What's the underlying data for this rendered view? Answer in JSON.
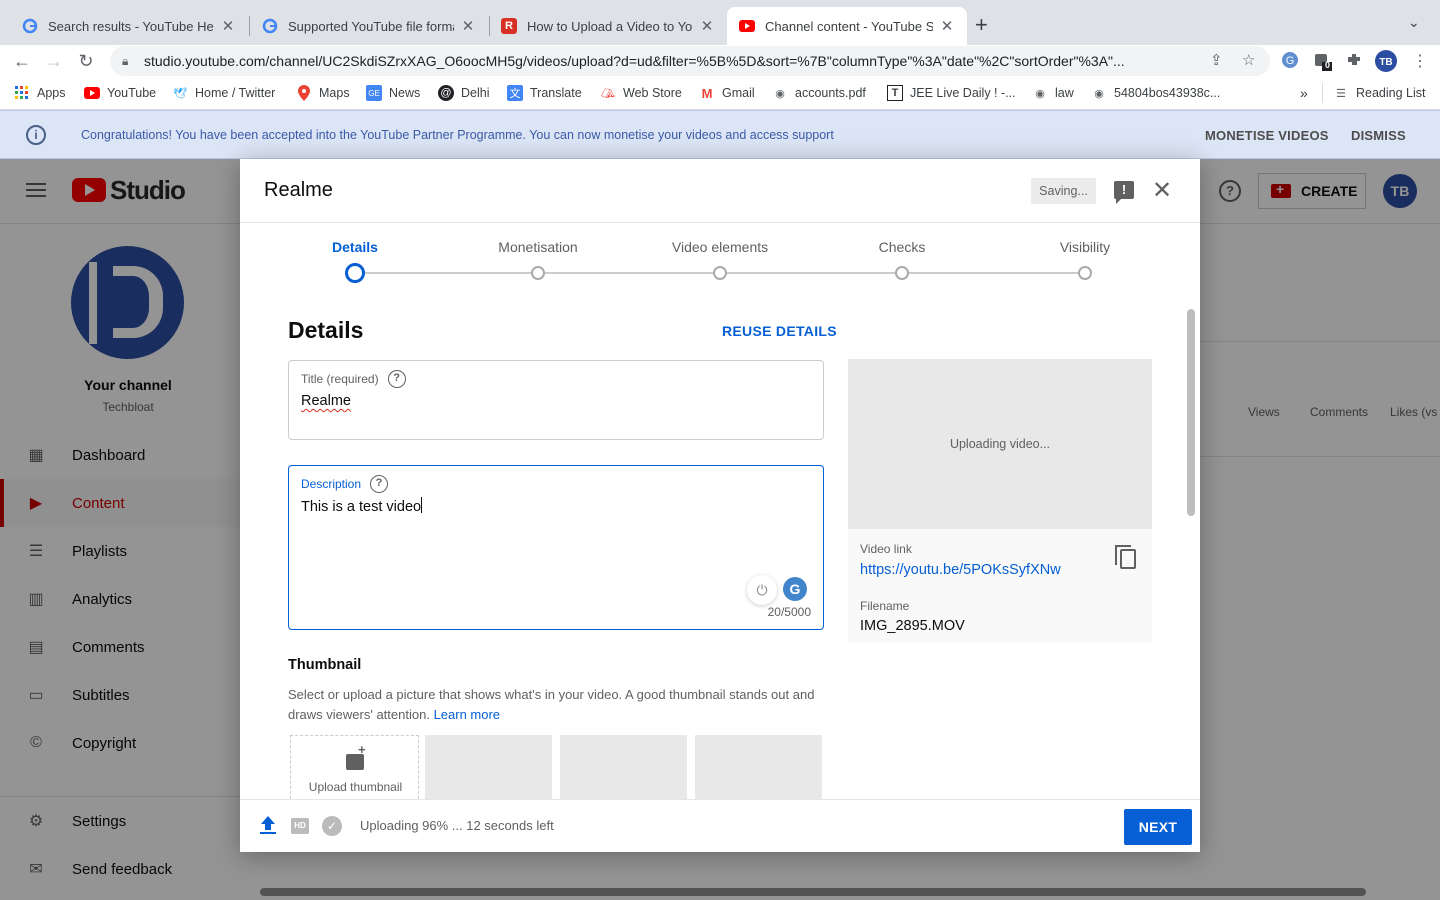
{
  "browser": {
    "tabs": [
      {
        "title": "Search results - YouTube Help",
        "icon": "google-icon",
        "active": false
      },
      {
        "title": "Supported YouTube file formats",
        "icon": "google-icon",
        "active": false
      },
      {
        "title": "How to Upload a Video to YouTube",
        "icon": "r-site-icon",
        "active": false
      },
      {
        "title": "Channel content - YouTube Studio",
        "icon": "youtube-icon",
        "active": true
      }
    ],
    "url": "studio.youtube.com/channel/UC2SkdiSZrxXAG_O6oocMH5g/videos/upload?d=ud&filter=%5B%5D&sort=%7B\"columnType\"%3A\"date\"%2C\"sortOrder\"%3A\"...",
    "extension_badge": "0",
    "bookmarks": [
      {
        "label": "Apps",
        "icon": "apps-grid-icon"
      },
      {
        "label": "YouTube",
        "icon": "youtube-icon"
      },
      {
        "label": "Home / Twitter",
        "icon": "twitter-icon"
      },
      {
        "label": "Maps",
        "icon": "maps-pin-icon"
      },
      {
        "label": "News",
        "icon": "news-icon"
      },
      {
        "label": "Delhi",
        "icon": "delhi-icon"
      },
      {
        "label": "Translate",
        "icon": "translate-icon"
      },
      {
        "label": "Web Store",
        "icon": "web-store-icon"
      },
      {
        "label": "Gmail",
        "icon": "gmail-icon"
      },
      {
        "label": "accounts.pdf",
        "icon": "globe-icon"
      },
      {
        "label": "JEE Live Daily ! -...",
        "icon": "jee-icon"
      },
      {
        "label": "law",
        "icon": "globe-icon"
      },
      {
        "label": "54804bos43938c...",
        "icon": "globe-icon"
      }
    ],
    "bookmarks_overflow": "»",
    "reading_list": "Reading List"
  },
  "banner": {
    "message": "Congratulations! You have been accepted into the YouTube Partner Programme. You can now monetise your videos and access support",
    "monetise": "MONETISE VIDEOS",
    "dismiss": "DISMISS"
  },
  "studio": {
    "logo_text": "Studio",
    "create": "CREATE",
    "channel_label": "Your channel",
    "channel_name": "Techbloat",
    "nav": [
      {
        "label": "Dashboard",
        "icon": "dashboard-icon",
        "active": false
      },
      {
        "label": "Content",
        "icon": "content-icon",
        "active": true
      },
      {
        "label": "Playlists",
        "icon": "playlists-icon",
        "active": false
      },
      {
        "label": "Analytics",
        "icon": "analytics-icon",
        "active": false
      },
      {
        "label": "Comments",
        "icon": "comments-icon",
        "active": false
      },
      {
        "label": "Subtitles",
        "icon": "subtitles-icon",
        "active": false
      },
      {
        "label": "Copyright",
        "icon": "copyright-icon",
        "active": false
      }
    ],
    "nav_bottom": [
      {
        "label": "Settings",
        "icon": "gear-icon"
      },
      {
        "label": "Send feedback",
        "icon": "feedback-icon"
      }
    ],
    "columns": [
      "Views",
      "Comments",
      "Likes (vs"
    ]
  },
  "dialog": {
    "title": "Realme",
    "saving": "Saving...",
    "steps": [
      {
        "label": "Details",
        "active": true
      },
      {
        "label": "Monetisation",
        "active": false
      },
      {
        "label": "Video elements",
        "active": false
      },
      {
        "label": "Checks",
        "active": false
      },
      {
        "label": "Visibility",
        "active": false
      }
    ],
    "section_title": "Details",
    "reuse": "REUSE DETAILS",
    "title_field": {
      "label": "Title (required)",
      "value": "Realme"
    },
    "description_field": {
      "label": "Description",
      "value": "This is a test video",
      "counter": "20/5000"
    },
    "preview": {
      "status": "Uploading video...",
      "link_label": "Video link",
      "link": "https://youtu.be/5POKsSyfXNw",
      "filename_label": "Filename",
      "filename": "IMG_2895.MOV"
    },
    "thumbnail": {
      "title": "Thumbnail",
      "description": "Select or upload a picture that shows what's in your video. A good thumbnail stands out and draws viewers' attention.",
      "learn_more": "Learn more",
      "upload_label": "Upload thumbnail"
    },
    "footer": {
      "status": "Uploading 96% ... 12 seconds left",
      "upload_percent": 96,
      "next": "NEXT"
    }
  }
}
